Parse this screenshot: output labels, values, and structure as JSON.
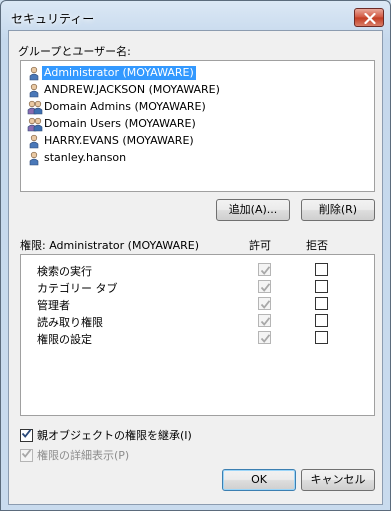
{
  "window": {
    "title": "セキュリティー"
  },
  "groups": {
    "label": "グループとユーザー名:",
    "users": [
      {
        "name": "Administrator (MOYAWARE)",
        "icon": "user-icon",
        "selected": true
      },
      {
        "name": "ANDREW.JACKSON (MOYAWARE)",
        "icon": "user-icon",
        "selected": false
      },
      {
        "name": "Domain Admins (MOYAWARE)",
        "icon": "group-icon",
        "selected": false
      },
      {
        "name": "Domain Users (MOYAWARE)",
        "icon": "group-icon",
        "selected": false
      },
      {
        "name": "HARRY.EVANS (MOYAWARE)",
        "icon": "user-icon",
        "selected": false
      },
      {
        "name": "stanley.hanson",
        "icon": "user-icon",
        "selected": false
      }
    ],
    "add_button": "追加(A)...",
    "remove_button": "削除(R)"
  },
  "permissions": {
    "label": "権限: Administrator (MOYAWARE)",
    "allow_header": "許可",
    "deny_header": "拒否",
    "rows": [
      {
        "name": "検索の実行",
        "allow": true,
        "deny": false
      },
      {
        "name": "カテゴリー タブ",
        "allow": true,
        "deny": false
      },
      {
        "name": "管理者",
        "allow": true,
        "deny": false
      },
      {
        "name": "読み取り権限",
        "allow": true,
        "deny": false
      },
      {
        "name": "権限の設定",
        "allow": true,
        "deny": false
      }
    ]
  },
  "options": {
    "inherit_label": "親オブジェクトの権限を継承(I)",
    "inherit_checked": true,
    "advanced_label": "権限の詳細表示(P)",
    "advanced_checked": true
  },
  "footer": {
    "ok_button": "OK",
    "cancel_button": "キャンセル"
  },
  "colors": {
    "selection": "#3399ff",
    "window_frame": "#c5d8ec",
    "close_button": "#c23c22"
  }
}
